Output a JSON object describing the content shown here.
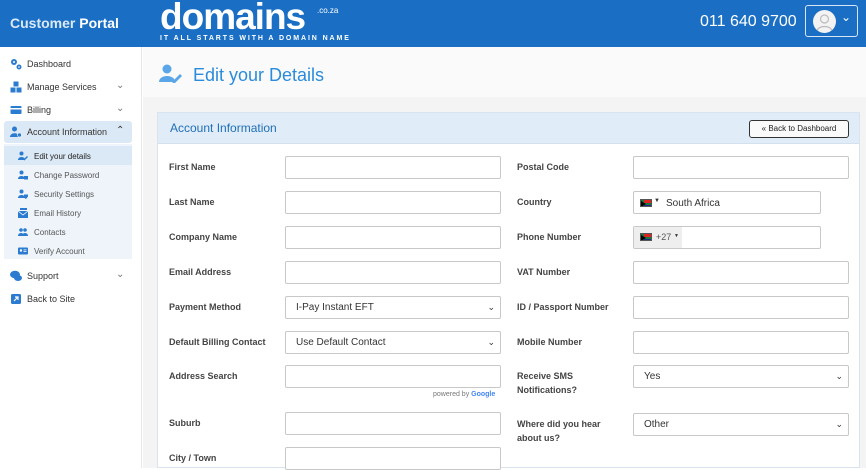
{
  "header": {
    "portal_title_1": "Customer",
    "portal_title_2": "Portal",
    "logo_word": "domains",
    "logo_tld": ".co.za",
    "logo_tagline": "IT ALL STARTS WITH A DOMAIN NAME",
    "phone": "011 640 9700",
    "colors": {
      "bar": "#1a6fc4",
      "accent": "#2b8bdc"
    }
  },
  "sidebar": {
    "items": [
      {
        "label": "Dashboard",
        "icon": "cogs-icon"
      },
      {
        "label": "Manage Services",
        "icon": "boxes-icon"
      },
      {
        "label": "Billing",
        "icon": "credit-card-icon"
      },
      {
        "label": "Account Information",
        "icon": "user-cog-icon"
      },
      {
        "label": "Support",
        "icon": "comments-icon"
      },
      {
        "label": "Back to Site",
        "icon": "external-link-icon"
      }
    ],
    "subitems": [
      {
        "label": "Edit your details",
        "icon": "user-edit-icon"
      },
      {
        "label": "Change Password",
        "icon": "user-lock-icon"
      },
      {
        "label": "Security Settings",
        "icon": "user-shield-icon"
      },
      {
        "label": "Email History",
        "icon": "mail-bulk-icon"
      },
      {
        "label": "Contacts",
        "icon": "users-icon"
      },
      {
        "label": "Verify Account",
        "icon": "id-card-icon"
      }
    ]
  },
  "page": {
    "title": "Edit your Details",
    "card_title": "Account Information",
    "back_button": "Back to Dashboard"
  },
  "form": {
    "left": {
      "first_name": "First Name",
      "last_name": "Last Name",
      "company_name": "Company Name",
      "email_address": "Email Address",
      "payment_method": "Payment Method",
      "payment_method_value": "I-Pay Instant EFT",
      "default_billing_contact": "Default Billing Contact",
      "default_billing_contact_value": "Use Default Contact",
      "address_search": "Address Search",
      "powered_by": "powered by",
      "google": "Google",
      "suburb": "Suburb",
      "city_town": "City / Town"
    },
    "right": {
      "postal_code": "Postal Code",
      "country": "Country",
      "country_value": "South Africa",
      "phone_number": "Phone Number",
      "phone_prefix": "+27",
      "vat_number": "VAT Number",
      "id_passport": "ID / Passport Number",
      "mobile_number": "Mobile Number",
      "receive_sms_1": "Receive SMS",
      "receive_sms_2": "Notifications?",
      "receive_sms_value": "Yes",
      "hear_about_1": "Where did you hear",
      "hear_about_2": "about us?",
      "hear_about_value": "Other"
    }
  }
}
